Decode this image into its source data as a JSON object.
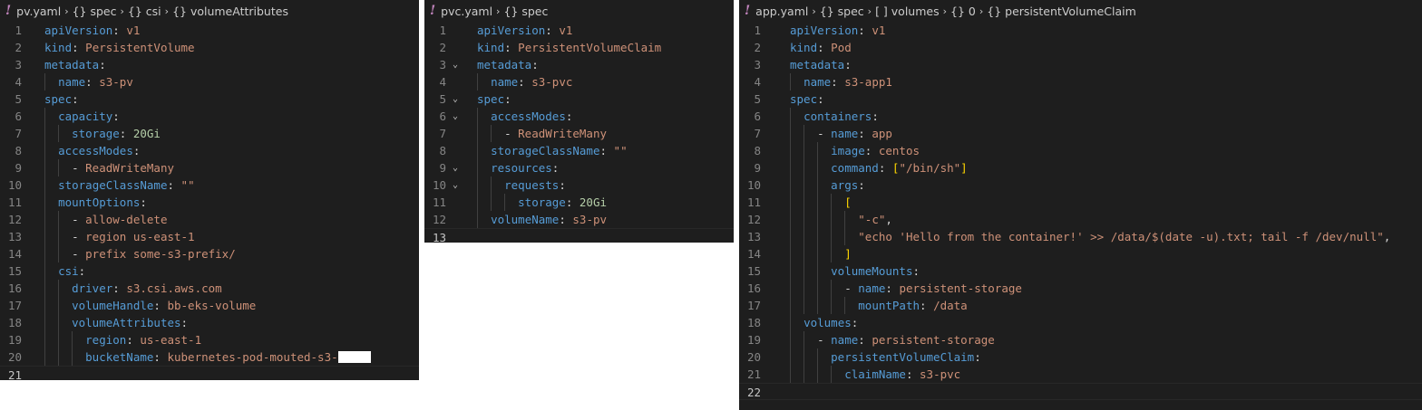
{
  "colors": {
    "editor_bg": "#1e1e1e",
    "key": "#569cd6",
    "string": "#ce9178",
    "number": "#b5cea8",
    "punct": "#d4d4d4",
    "bracket": "#ffd700",
    "breadcrumb_icon": "#c586c0"
  },
  "panes": [
    {
      "id": "pv",
      "breadcrumb": [
        "pv.yaml",
        "{} spec",
        "{} csi",
        "{} volumeAttributes"
      ],
      "lines": [
        {
          "n": "1",
          "t": [
            {
              "c": "k",
              "s": "apiVersion"
            },
            {
              "c": "p",
              "s": ": "
            },
            {
              "c": "v",
              "s": "v1"
            }
          ]
        },
        {
          "n": "2",
          "t": [
            {
              "c": "k",
              "s": "kind"
            },
            {
              "c": "p",
              "s": ": "
            },
            {
              "c": "v",
              "s": "PersistentVolume"
            }
          ]
        },
        {
          "n": "3",
          "t": [
            {
              "c": "k",
              "s": "metadata"
            },
            {
              "c": "p",
              "s": ":"
            }
          ]
        },
        {
          "n": "4",
          "t": [
            {
              "c": "p",
              "s": "  "
            },
            {
              "c": "k",
              "s": "name"
            },
            {
              "c": "p",
              "s": ": "
            },
            {
              "c": "v",
              "s": "s3-pv"
            }
          ]
        },
        {
          "n": "5",
          "t": [
            {
              "c": "k",
              "s": "spec"
            },
            {
              "c": "p",
              "s": ":"
            }
          ]
        },
        {
          "n": "6",
          "t": [
            {
              "c": "p",
              "s": "  "
            },
            {
              "c": "k",
              "s": "capacity"
            },
            {
              "c": "p",
              "s": ":"
            }
          ]
        },
        {
          "n": "7",
          "t": [
            {
              "c": "p",
              "s": "    "
            },
            {
              "c": "k",
              "s": "storage"
            },
            {
              "c": "p",
              "s": ": "
            },
            {
              "c": "n",
              "s": "20Gi"
            }
          ]
        },
        {
          "n": "8",
          "t": [
            {
              "c": "p",
              "s": "  "
            },
            {
              "c": "k",
              "s": "accessModes"
            },
            {
              "c": "p",
              "s": ":"
            }
          ]
        },
        {
          "n": "9",
          "t": [
            {
              "c": "p",
              "s": "    - "
            },
            {
              "c": "v",
              "s": "ReadWriteMany"
            }
          ]
        },
        {
          "n": "10",
          "t": [
            {
              "c": "p",
              "s": "  "
            },
            {
              "c": "k",
              "s": "storageClassName"
            },
            {
              "c": "p",
              "s": ": "
            },
            {
              "c": "v",
              "s": "\"\""
            }
          ]
        },
        {
          "n": "11",
          "t": [
            {
              "c": "p",
              "s": "  "
            },
            {
              "c": "k",
              "s": "mountOptions"
            },
            {
              "c": "p",
              "s": ":"
            }
          ]
        },
        {
          "n": "12",
          "t": [
            {
              "c": "p",
              "s": "    - "
            },
            {
              "c": "v",
              "s": "allow-delete"
            }
          ]
        },
        {
          "n": "13",
          "t": [
            {
              "c": "p",
              "s": "    - "
            },
            {
              "c": "v",
              "s": "region us-east-1"
            }
          ]
        },
        {
          "n": "14",
          "t": [
            {
              "c": "p",
              "s": "    - "
            },
            {
              "c": "v",
              "s": "prefix some-s3-prefix/"
            }
          ]
        },
        {
          "n": "15",
          "t": [
            {
              "c": "p",
              "s": "  "
            },
            {
              "c": "k",
              "s": "csi"
            },
            {
              "c": "p",
              "s": ":"
            }
          ]
        },
        {
          "n": "16",
          "t": [
            {
              "c": "p",
              "s": "    "
            },
            {
              "c": "k",
              "s": "driver"
            },
            {
              "c": "p",
              "s": ": "
            },
            {
              "c": "v",
              "s": "s3.csi.aws.com"
            }
          ]
        },
        {
          "n": "17",
          "t": [
            {
              "c": "p",
              "s": "    "
            },
            {
              "c": "k",
              "s": "volumeHandle"
            },
            {
              "c": "p",
              "s": ": "
            },
            {
              "c": "v",
              "s": "bb-eks-volume"
            }
          ]
        },
        {
          "n": "18",
          "t": [
            {
              "c": "p",
              "s": "    "
            },
            {
              "c": "k",
              "s": "volumeAttributes"
            },
            {
              "c": "p",
              "s": ":"
            }
          ]
        },
        {
          "n": "19",
          "t": [
            {
              "c": "p",
              "s": "      "
            },
            {
              "c": "k",
              "s": "region"
            },
            {
              "c": "p",
              "s": ": "
            },
            {
              "c": "v",
              "s": "us-east-1"
            }
          ]
        },
        {
          "n": "20",
          "t": [
            {
              "c": "p",
              "s": "      "
            },
            {
              "c": "k",
              "s": "bucketName"
            },
            {
              "c": "p",
              "s": ": "
            },
            {
              "c": "v",
              "s": "kubernetes-pod-mouted-s3-"
            },
            {
              "c": "redact",
              "s": ""
            }
          ]
        },
        {
          "n": "21",
          "t": [],
          "active": true
        }
      ]
    },
    {
      "id": "pvc",
      "breadcrumb": [
        "pvc.yaml",
        "{} spec"
      ],
      "lines": [
        {
          "n": "1",
          "t": [
            {
              "c": "k",
              "s": "apiVersion"
            },
            {
              "c": "p",
              "s": ": "
            },
            {
              "c": "v",
              "s": "v1"
            }
          ]
        },
        {
          "n": "2",
          "t": [
            {
              "c": "k",
              "s": "kind"
            },
            {
              "c": "p",
              "s": ": "
            },
            {
              "c": "v",
              "s": "PersistentVolumeClaim"
            }
          ]
        },
        {
          "n": "3",
          "fold": true,
          "t": [
            {
              "c": "k",
              "s": "metadata"
            },
            {
              "c": "p",
              "s": ":"
            }
          ]
        },
        {
          "n": "4",
          "t": [
            {
              "c": "p",
              "s": "  "
            },
            {
              "c": "k",
              "s": "name"
            },
            {
              "c": "p",
              "s": ": "
            },
            {
              "c": "v",
              "s": "s3-pvc"
            }
          ]
        },
        {
          "n": "5",
          "fold": true,
          "t": [
            {
              "c": "k",
              "s": "spec"
            },
            {
              "c": "p",
              "s": ":"
            }
          ]
        },
        {
          "n": "6",
          "fold": true,
          "t": [
            {
              "c": "p",
              "s": "  "
            },
            {
              "c": "k",
              "s": "accessModes"
            },
            {
              "c": "p",
              "s": ":"
            }
          ]
        },
        {
          "n": "7",
          "t": [
            {
              "c": "p",
              "s": "    - "
            },
            {
              "c": "v",
              "s": "ReadWriteMany"
            }
          ]
        },
        {
          "n": "8",
          "t": [
            {
              "c": "p",
              "s": "  "
            },
            {
              "c": "k",
              "s": "storageClassName"
            },
            {
              "c": "p",
              "s": ": "
            },
            {
              "c": "v",
              "s": "\"\""
            }
          ]
        },
        {
          "n": "9",
          "fold": true,
          "t": [
            {
              "c": "p",
              "s": "  "
            },
            {
              "c": "k",
              "s": "resources"
            },
            {
              "c": "p",
              "s": ":"
            }
          ]
        },
        {
          "n": "10",
          "fold": true,
          "t": [
            {
              "c": "p",
              "s": "    "
            },
            {
              "c": "k",
              "s": "requests"
            },
            {
              "c": "p",
              "s": ":"
            }
          ]
        },
        {
          "n": "11",
          "t": [
            {
              "c": "p",
              "s": "      "
            },
            {
              "c": "k",
              "s": "storage"
            },
            {
              "c": "p",
              "s": ": "
            },
            {
              "c": "n",
              "s": "20Gi"
            }
          ]
        },
        {
          "n": "12",
          "t": [
            {
              "c": "p",
              "s": "  "
            },
            {
              "c": "k",
              "s": "volumeName"
            },
            {
              "c": "p",
              "s": ": "
            },
            {
              "c": "v",
              "s": "s3-pv"
            }
          ]
        },
        {
          "n": "13",
          "t": [],
          "active": true
        }
      ]
    },
    {
      "id": "app",
      "breadcrumb": [
        "app.yaml",
        "{} spec",
        "[ ] volumes",
        "{} 0",
        "{} persistentVolumeClaim"
      ],
      "lines": [
        {
          "n": "1",
          "t": [
            {
              "c": "k",
              "s": "apiVersion"
            },
            {
              "c": "p",
              "s": ": "
            },
            {
              "c": "v",
              "s": "v1"
            }
          ]
        },
        {
          "n": "2",
          "t": [
            {
              "c": "k",
              "s": "kind"
            },
            {
              "c": "p",
              "s": ": "
            },
            {
              "c": "v",
              "s": "Pod"
            }
          ]
        },
        {
          "n": "3",
          "t": [
            {
              "c": "k",
              "s": "metadata"
            },
            {
              "c": "p",
              "s": ":"
            }
          ]
        },
        {
          "n": "4",
          "t": [
            {
              "c": "p",
              "s": "  "
            },
            {
              "c": "k",
              "s": "name"
            },
            {
              "c": "p",
              "s": ": "
            },
            {
              "c": "v",
              "s": "s3-app1"
            }
          ]
        },
        {
          "n": "5",
          "t": [
            {
              "c": "k",
              "s": "spec"
            },
            {
              "c": "p",
              "s": ":"
            }
          ]
        },
        {
          "n": "6",
          "t": [
            {
              "c": "p",
              "s": "  "
            },
            {
              "c": "k",
              "s": "containers"
            },
            {
              "c": "p",
              "s": ":"
            }
          ]
        },
        {
          "n": "7",
          "t": [
            {
              "c": "p",
              "s": "    - "
            },
            {
              "c": "k",
              "s": "name"
            },
            {
              "c": "p",
              "s": ": "
            },
            {
              "c": "v",
              "s": "app"
            }
          ]
        },
        {
          "n": "8",
          "t": [
            {
              "c": "p",
              "s": "      "
            },
            {
              "c": "k",
              "s": "image"
            },
            {
              "c": "p",
              "s": ": "
            },
            {
              "c": "v",
              "s": "centos"
            }
          ]
        },
        {
          "n": "9",
          "t": [
            {
              "c": "p",
              "s": "      "
            },
            {
              "c": "k",
              "s": "command"
            },
            {
              "c": "p",
              "s": ": "
            },
            {
              "c": "br",
              "s": "["
            },
            {
              "c": "v",
              "s": "\"/bin/sh\""
            },
            {
              "c": "br",
              "s": "]"
            }
          ]
        },
        {
          "n": "10",
          "t": [
            {
              "c": "p",
              "s": "      "
            },
            {
              "c": "k",
              "s": "args"
            },
            {
              "c": "p",
              "s": ":"
            }
          ]
        },
        {
          "n": "11",
          "t": [
            {
              "c": "p",
              "s": "        "
            },
            {
              "c": "br",
              "s": "["
            }
          ]
        },
        {
          "n": "12",
          "t": [
            {
              "c": "p",
              "s": "          "
            },
            {
              "c": "v",
              "s": "\"-c\""
            },
            {
              "c": "p",
              "s": ","
            }
          ]
        },
        {
          "n": "13",
          "t": [
            {
              "c": "p",
              "s": "          "
            },
            {
              "c": "v",
              "s": "\"echo 'Hello from the container!' >> /data/$(date -u).txt; tail -f /dev/null\""
            },
            {
              "c": "p",
              "s": ","
            }
          ]
        },
        {
          "n": "14",
          "t": [
            {
              "c": "p",
              "s": "        "
            },
            {
              "c": "br",
              "s": "]"
            }
          ]
        },
        {
          "n": "15",
          "t": [
            {
              "c": "p",
              "s": "      "
            },
            {
              "c": "k",
              "s": "volumeMounts"
            },
            {
              "c": "p",
              "s": ":"
            }
          ]
        },
        {
          "n": "16",
          "t": [
            {
              "c": "p",
              "s": "        - "
            },
            {
              "c": "k",
              "s": "name"
            },
            {
              "c": "p",
              "s": ": "
            },
            {
              "c": "v",
              "s": "persistent-storage"
            }
          ]
        },
        {
          "n": "17",
          "t": [
            {
              "c": "p",
              "s": "          "
            },
            {
              "c": "k",
              "s": "mountPath"
            },
            {
              "c": "p",
              "s": ": "
            },
            {
              "c": "v",
              "s": "/data"
            }
          ]
        },
        {
          "n": "18",
          "t": [
            {
              "c": "p",
              "s": "  "
            },
            {
              "c": "k",
              "s": "volumes"
            },
            {
              "c": "p",
              "s": ":"
            }
          ]
        },
        {
          "n": "19",
          "t": [
            {
              "c": "p",
              "s": "    - "
            },
            {
              "c": "k",
              "s": "name"
            },
            {
              "c": "p",
              "s": ": "
            },
            {
              "c": "v",
              "s": "persistent-storage"
            }
          ]
        },
        {
          "n": "20",
          "t": [
            {
              "c": "p",
              "s": "      "
            },
            {
              "c": "k",
              "s": "persistentVolumeClaim"
            },
            {
              "c": "p",
              "s": ":"
            }
          ]
        },
        {
          "n": "21",
          "t": [
            {
              "c": "p",
              "s": "        "
            },
            {
              "c": "k",
              "s": "claimName"
            },
            {
              "c": "p",
              "s": ": "
            },
            {
              "c": "v",
              "s": "s3-pvc"
            }
          ]
        },
        {
          "n": "22",
          "t": [],
          "active": true
        }
      ]
    }
  ]
}
